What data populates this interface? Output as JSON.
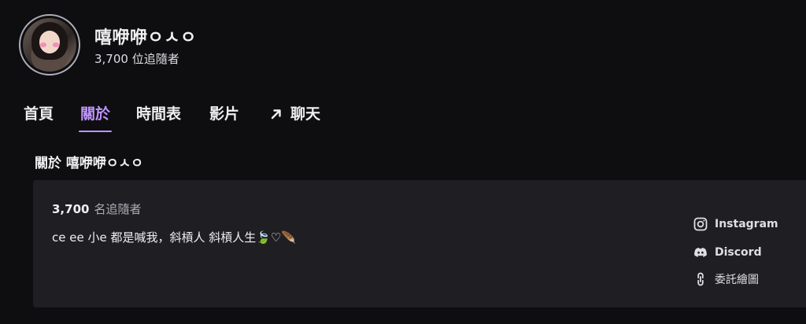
{
  "header": {
    "channel_name": "嘻咿咿ㅇㅅㅇ",
    "followers_text": "3,700 位追隨者"
  },
  "tabs": [
    {
      "label": "首頁",
      "active": false
    },
    {
      "label": "關於",
      "active": true
    },
    {
      "label": "時間表",
      "active": false
    },
    {
      "label": "影片",
      "active": false
    },
    {
      "label": "聊天",
      "active": false,
      "icon": "external-arrow-icon"
    }
  ],
  "about": {
    "heading": "關於 嘻咿咿ㅇㅅㅇ",
    "followers_count": "3,700",
    "followers_label": "名追隨者",
    "bio": "ce ee 小e 都是喊我，斜槓人 斜槓人生🍃♡🪶"
  },
  "social_links": [
    {
      "label": "Instagram",
      "icon": "instagram-icon"
    },
    {
      "label": "Discord",
      "icon": "discord-icon"
    },
    {
      "label": "委託繪圖",
      "icon": "link-icon"
    }
  ],
  "colors": {
    "background": "#0e0e10",
    "panel": "#1f1f23",
    "accent": "#bf94ff",
    "text": "#efeff1",
    "muted": "#adadb8"
  }
}
